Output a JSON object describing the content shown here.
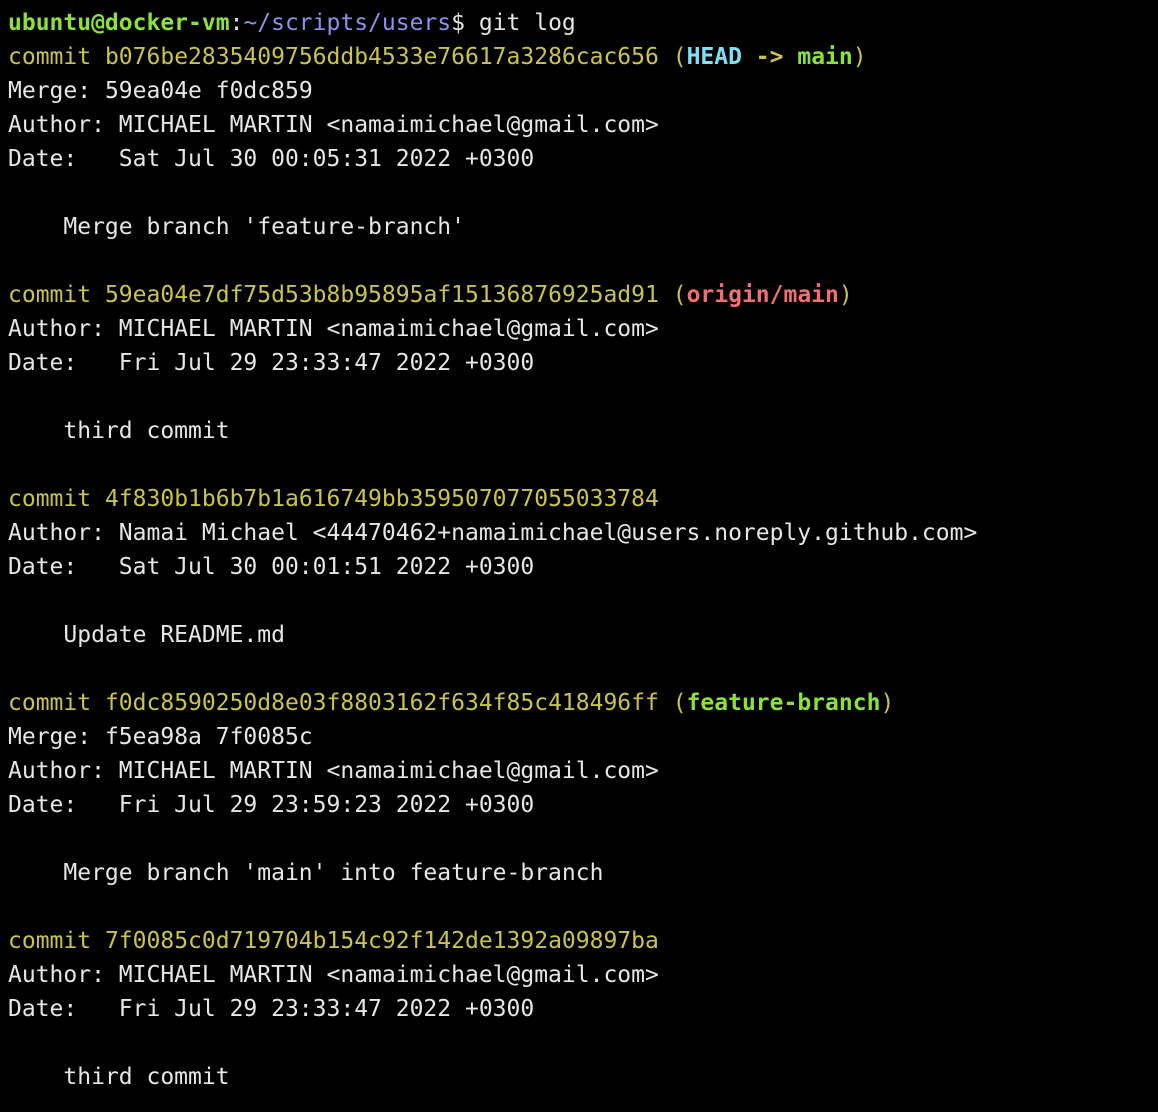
{
  "prompt": {
    "user_host": "ubuntu@docker-vm",
    "separator": ":",
    "path": "~/scripts/users",
    "symbol": "$ ",
    "command": "git log"
  },
  "labels": {
    "commit": "commit",
    "merge": "Merge:",
    "author": "Author:",
    "date": "Date:"
  },
  "colors": {
    "background": "#000000",
    "text": "#e6e6e6",
    "commit_yellow": "#c9c34a",
    "prompt_green": "#8ae234",
    "path_blue": "#8f8ff0",
    "head_cyan": "#7fe0f5",
    "origin_red": "#ef6f6f"
  },
  "commits": [
    {
      "hash": "b076be2835409756ddb4533e76617a3286cac656",
      "refs_head": "HEAD",
      "refs_arrow": " -> ",
      "refs_branch": "main",
      "merge": "59ea04e f0dc859",
      "author": "MICHAEL MARTIN <namaimichael@gmail.com>",
      "date": "Sat Jul 30 00:05:31 2022 +0300",
      "message": "Merge branch 'feature-branch'"
    },
    {
      "hash": "59ea04e7df75d53b8b95895af15136876925ad91",
      "refs_origin": "origin/main",
      "author": "MICHAEL MARTIN <namaimichael@gmail.com>",
      "date": "Fri Jul 29 23:33:47 2022 +0300",
      "message": "third commit"
    },
    {
      "hash": "4f830b1b6b7b1a616749bb359507077055033784",
      "author": "Namai Michael <44470462+namaimichael@users.noreply.github.com>",
      "date": "Sat Jul 30 00:01:51 2022 +0300",
      "message": "Update README.md"
    },
    {
      "hash": "f0dc8590250d8e03f8803162f634f85c418496ff",
      "refs_feature": "feature-branch",
      "merge": "f5ea98a 7f0085c",
      "author": "MICHAEL MARTIN <namaimichael@gmail.com>",
      "date": "Fri Jul 29 23:59:23 2022 +0300",
      "message": "Merge branch 'main' into feature-branch"
    },
    {
      "hash": "7f0085c0d719704b154c92f142de1392a09897ba",
      "author": "MICHAEL MARTIN <namaimichael@gmail.com>",
      "date": "Fri Jul 29 23:33:47 2022 +0300",
      "message": "third commit"
    }
  ]
}
